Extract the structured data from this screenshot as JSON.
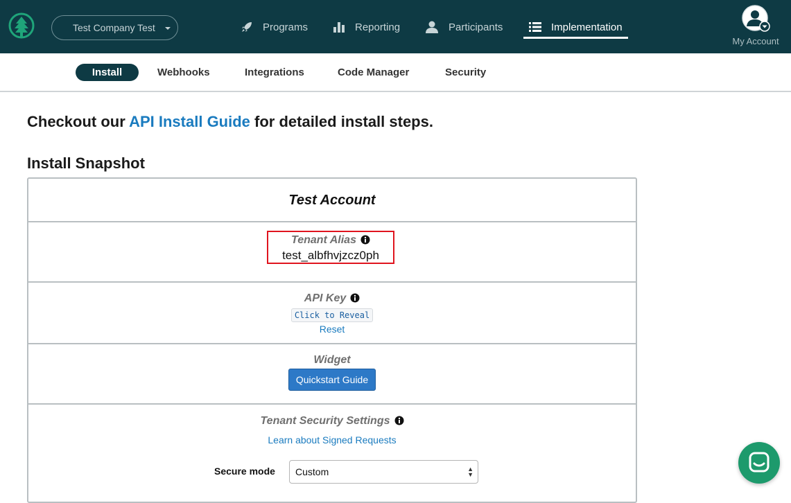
{
  "header": {
    "company": "Test Company Test",
    "nav": [
      {
        "label": "Programs",
        "icon": "rocket-icon"
      },
      {
        "label": "Reporting",
        "icon": "bar-chart-icon"
      },
      {
        "label": "Participants",
        "icon": "person-icon"
      },
      {
        "label": "Implementation",
        "icon": "list-icon",
        "active": true
      }
    ],
    "account_label": "My Account"
  },
  "subnav": {
    "tabs": [
      {
        "label": "Install",
        "active": true
      },
      {
        "label": "Webhooks"
      },
      {
        "label": "Integrations"
      },
      {
        "label": "Code Manager"
      },
      {
        "label": "Security"
      }
    ]
  },
  "main": {
    "headline_before": "Checkout our ",
    "headline_link": "API Install Guide",
    "headline_after": " for detailed install steps.",
    "section_title": "Install Snapshot",
    "card": {
      "title": "Test Account",
      "tenant_alias_label": "Tenant Alias",
      "tenant_alias_value": "test_albfhvjzcz0ph",
      "api_key_label": "API Key",
      "api_key_reveal": "Click to Reveal",
      "api_key_reset": "Reset",
      "widget_label": "Widget",
      "widget_button": "Quickstart Guide",
      "security_label": "Tenant Security Settings",
      "security_link": "Learn about Signed Requests",
      "secure_mode_label": "Secure mode",
      "secure_mode_value": "Custom"
    }
  },
  "colors": {
    "topbar": "#0e3a44",
    "accent_link": "#1a7bbf",
    "primary_button": "#2d79c7",
    "highlight_box": "#e0141e",
    "chat_button": "#1d9a6c"
  }
}
